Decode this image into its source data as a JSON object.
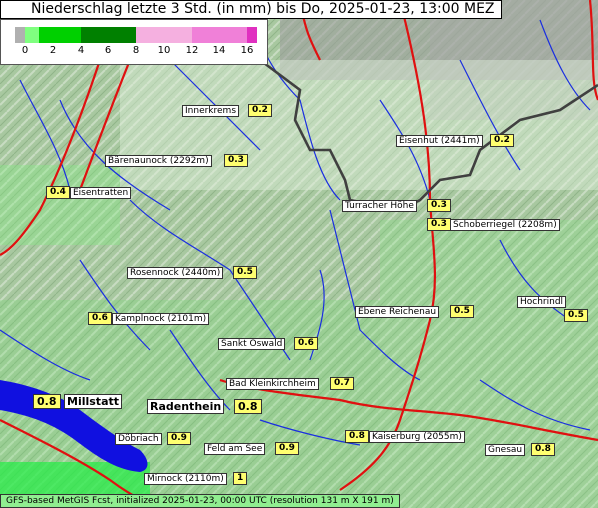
{
  "title": "Niederschlag letzte 3 Std. (in mm) bis Do, 2025-01-23, 13:00 MEZ",
  "legend": {
    "ticks": [
      "0",
      "2",
      "4",
      "6",
      "8",
      "10",
      "12",
      "14",
      "16"
    ],
    "colors": {
      "grey": "#b0b0b0",
      "light_green": "#80ff80",
      "green": "#00d000",
      "dark_green": "#008000",
      "light_pink": "#f5b0e0",
      "pink": "#f080d8",
      "magenta": "#e030c0"
    }
  },
  "places": [
    {
      "id": "innerkrems",
      "name": "Innerkrems",
      "value": "0.2"
    },
    {
      "id": "eisenhut",
      "name": "Eisenhut (2441m)",
      "value": "0.2"
    },
    {
      "id": "baerenaunock",
      "name": "Bärenaunock (2292m)",
      "value": "0.3"
    },
    {
      "id": "eisentratten",
      "name": "Eisentratten",
      "value": "0.4"
    },
    {
      "id": "turracher",
      "name": "Turracher Höhe",
      "value": "0.3"
    },
    {
      "id": "schoberriegel",
      "name": "Schoberriegel (2208m)",
      "value": "0.3"
    },
    {
      "id": "rosennock",
      "name": "Rosennock (2440m)",
      "value": "0.5"
    },
    {
      "id": "hochrindl",
      "name": "Hochrindl",
      "value": "0.5"
    },
    {
      "id": "kamplnock",
      "name": "Kamplnock (2101m)",
      "value": "0.6"
    },
    {
      "id": "ebene",
      "name": "Ebene Reichenau",
      "value": "0.5"
    },
    {
      "id": "sanktoswald",
      "name": "Sankt Oswald",
      "value": "0.6"
    },
    {
      "id": "badklein",
      "name": "Bad Kleinkirchheim",
      "value": "0.7"
    },
    {
      "id": "millstatt",
      "name": "Millstatt",
      "value": "0.8"
    },
    {
      "id": "radenthein",
      "name": "Radenthein",
      "value": "0.8"
    },
    {
      "id": "doebriach",
      "name": "Döbriach",
      "value": "0.9"
    },
    {
      "id": "feldamsee",
      "name": "Feld am See",
      "value": "0.9"
    },
    {
      "id": "kaiserburg",
      "name": "Kaiserburg (2055m)",
      "value": "0.8"
    },
    {
      "id": "gnesau",
      "name": "Gnesau",
      "value": "0.8"
    },
    {
      "id": "mirnock",
      "name": "Mirnock (2110m)",
      "value": "1"
    }
  ],
  "footer": "GFS-based MetGIS Fcst, initialized 2025-01-23, 00:00 UTC  (resolution 131 m X 191 m)"
}
